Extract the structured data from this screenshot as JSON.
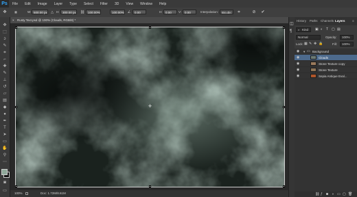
{
  "app": {
    "logo": "Ps"
  },
  "menu": [
    "File",
    "Edit",
    "Image",
    "Layer",
    "Type",
    "Select",
    "Filter",
    "3D",
    "View",
    "Window",
    "Help"
  ],
  "options": {
    "w_label": "W:",
    "w_value": "500.00 px",
    "h_label": "H:",
    "h_value": "300.00 px",
    "scale_w": "100.00%",
    "scale_h": "100.00%",
    "angle": "0.00",
    "hskew_label": "H:",
    "hskew": "0.00",
    "vskew_label": "V:",
    "vskew": "0.00",
    "interp_label": "Interpolation:",
    "interp_value": "Bicubic"
  },
  "document": {
    "tab_title": "Rusty Text.psd @ 100% (Clouds, RGB/8) *",
    "zoom": "100%",
    "doc_size": "Doc: 1.72M/8.61M"
  },
  "panels": {
    "tabs": [
      "History",
      "Paths",
      "Channels",
      "Layers"
    ],
    "active_tab": "Layers",
    "kind_label": "Kind",
    "blend_mode": "Normal",
    "opacity_label": "Opacity:",
    "opacity_value": "100%",
    "lock_label": "Lock:",
    "fill_label": "Fill:",
    "fill_value": "100%",
    "layers": [
      {
        "name": "Background",
        "type": "group"
      },
      {
        "name": "Clouds",
        "type": "layer",
        "selected": true
      },
      {
        "name": "Stone Texture copy",
        "type": "layer"
      },
      {
        "name": "Stone Texture",
        "type": "layer"
      },
      {
        "name": "Sepia Antique Eval...",
        "type": "layer"
      }
    ]
  },
  "colors": {
    "accent": "#31a8ff",
    "selected_layer": "#4d6a8c",
    "cloud_light": "#9fb6aa",
    "cloud_dark": "#0f1512"
  }
}
